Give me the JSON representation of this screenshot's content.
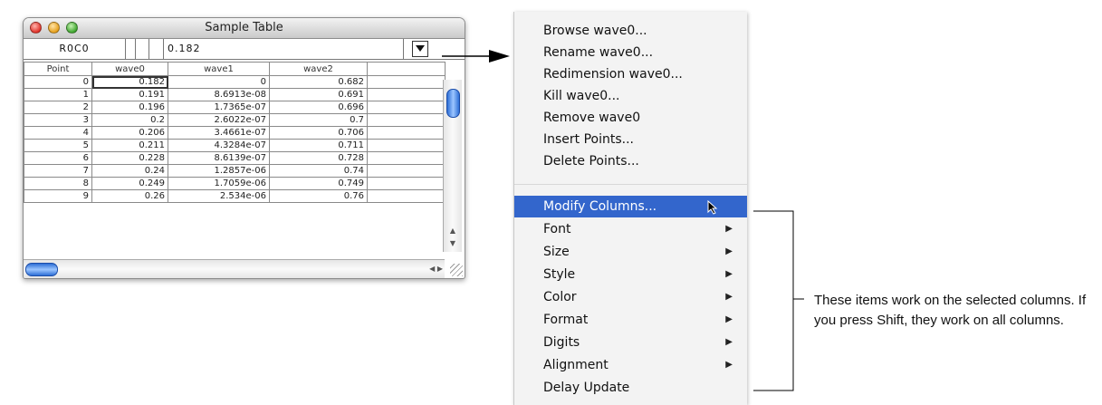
{
  "window": {
    "title": "Sample Table",
    "entry_name": "R0C0",
    "entry_value": "0.182"
  },
  "table": {
    "columns": [
      "Point",
      "wave0",
      "wave1",
      "wave2",
      ""
    ],
    "rows": [
      [
        "0",
        "0.182",
        "0",
        "0.682",
        ""
      ],
      [
        "1",
        "0.191",
        "8.6913e-08",
        "0.691",
        ""
      ],
      [
        "2",
        "0.196",
        "1.7365e-07",
        "0.696",
        ""
      ],
      [
        "3",
        "0.2",
        "2.6022e-07",
        "0.7",
        ""
      ],
      [
        "4",
        "0.206",
        "3.4661e-07",
        "0.706",
        ""
      ],
      [
        "5",
        "0.211",
        "4.3284e-07",
        "0.711",
        ""
      ],
      [
        "6",
        "0.228",
        "8.6139e-07",
        "0.728",
        ""
      ],
      [
        "7",
        "0.24",
        "1.2857e-06",
        "0.74",
        ""
      ],
      [
        "8",
        "0.249",
        "1.7059e-06",
        "0.749",
        ""
      ],
      [
        "9",
        "0.26",
        "2.534e-06",
        "0.76",
        ""
      ]
    ]
  },
  "menu": {
    "items": [
      {
        "label": "Browse wave0...",
        "submenu": false
      },
      {
        "label": "Rename wave0...",
        "submenu": false
      },
      {
        "label": "Redimension wave0...",
        "submenu": false
      },
      {
        "label": "Kill wave0...",
        "submenu": false
      },
      {
        "label": "Remove wave0",
        "submenu": false
      },
      {
        "label": "Insert Points...",
        "submenu": false
      },
      {
        "label": "Delete Points...",
        "submenu": false
      },
      {
        "label": "Modify Columns...",
        "submenu": false,
        "highlighted": true
      },
      {
        "label": "Font",
        "submenu": true
      },
      {
        "label": "Size",
        "submenu": true
      },
      {
        "label": "Style",
        "submenu": true
      },
      {
        "label": "Color",
        "submenu": true
      },
      {
        "label": "Format",
        "submenu": true
      },
      {
        "label": "Digits",
        "submenu": true
      },
      {
        "label": "Alignment",
        "submenu": true
      },
      {
        "label": "Delay Update",
        "submenu": false
      }
    ]
  },
  "note": "These items work on the selected columns. If you press Shift, they work on all columns.",
  "colors": {
    "highlight": "#3366cc",
    "menu_bg": "#f3f3f3",
    "scroll_thumb": "#2e6fd6"
  }
}
